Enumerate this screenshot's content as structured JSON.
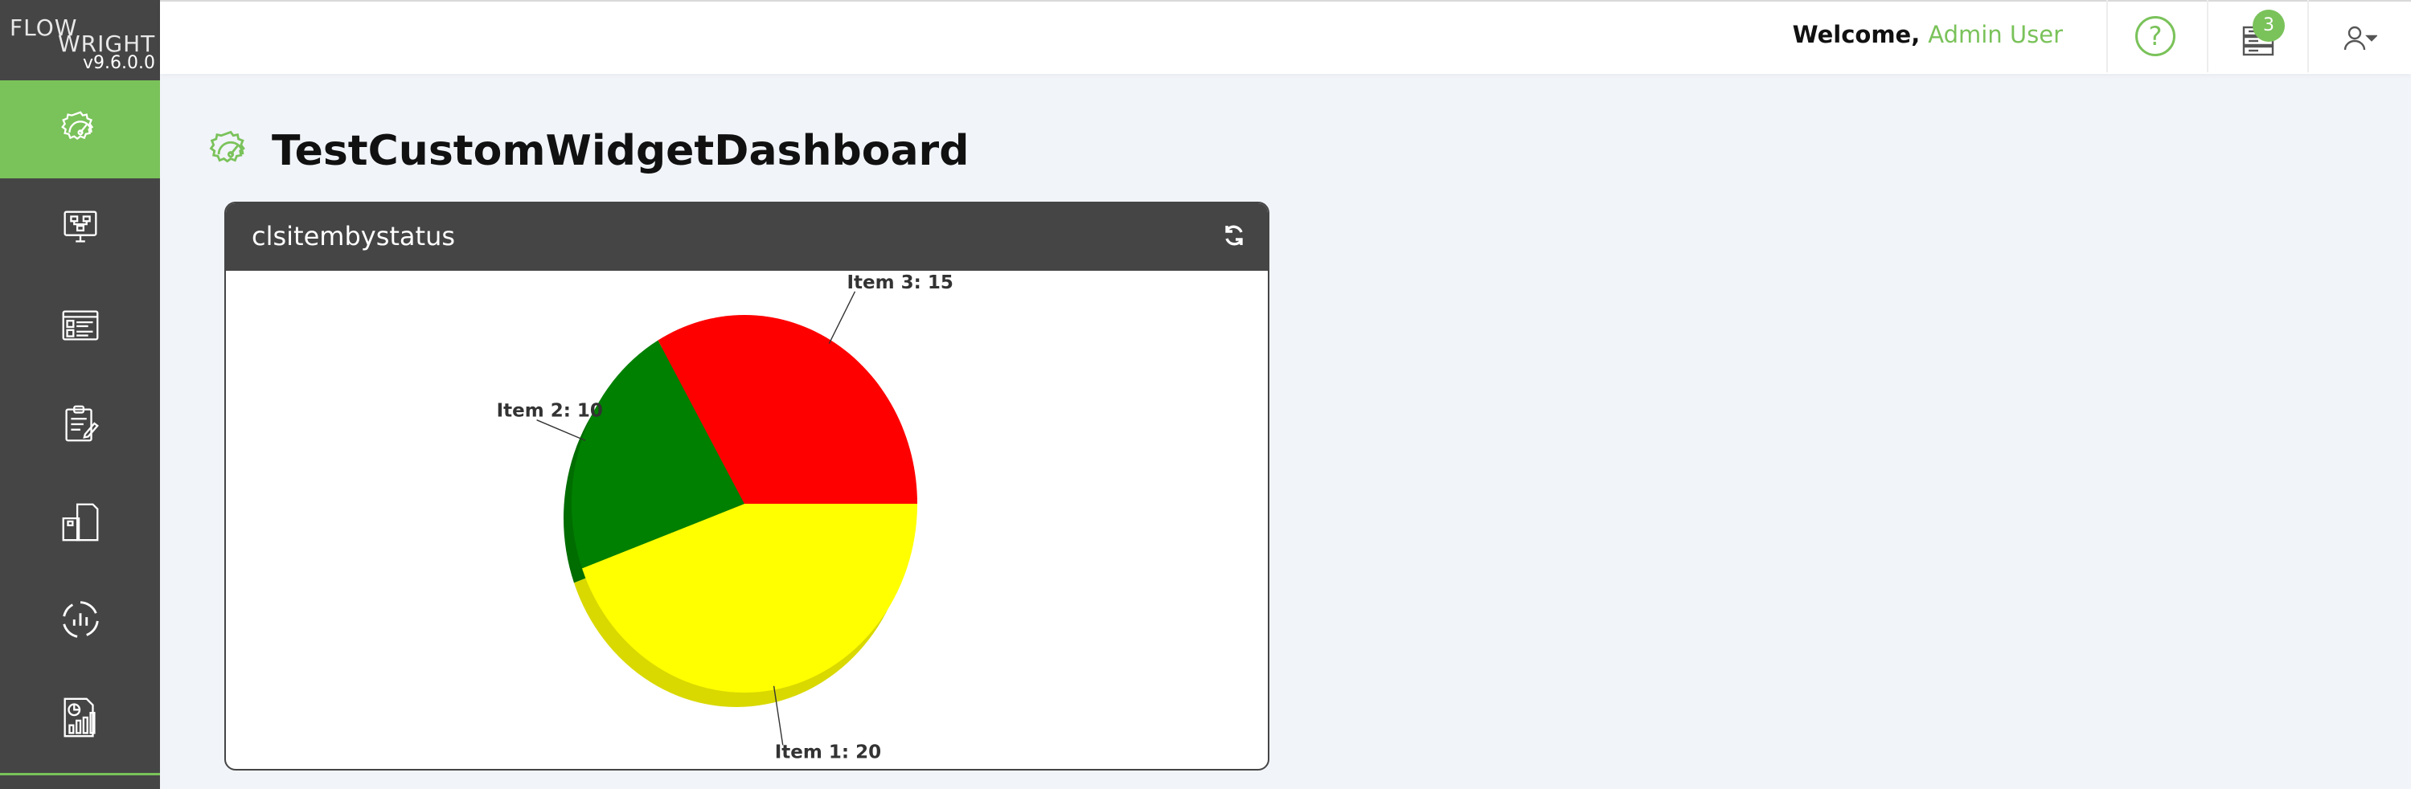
{
  "brand": {
    "logo_line1": "FLOW",
    "logo_line2": "WRIGHT",
    "version": "v9.6.0.0"
  },
  "sidebar": {
    "items": [
      {
        "name": "dashboard-gauge-icon",
        "active": true
      },
      {
        "name": "workflow-monitor-icon",
        "active": false
      },
      {
        "name": "forms-icon",
        "active": false
      },
      {
        "name": "tasks-clipboard-icon",
        "active": false
      },
      {
        "name": "documents-icon",
        "active": false
      },
      {
        "name": "analytics-cycle-icon",
        "active": false
      },
      {
        "name": "reports-icon",
        "active": false
      }
    ]
  },
  "header": {
    "welcome_label": "Welcome,",
    "user_name": "Admin User",
    "help_symbol": "?",
    "notification_count": "3"
  },
  "page": {
    "title": "TestCustomWidgetDashboard"
  },
  "widget": {
    "title": "clsitembystatus"
  },
  "chart_data": {
    "type": "pie",
    "style": "3d",
    "categories": [
      "Item 1",
      "Item 2",
      "Item 3"
    ],
    "values": [
      20,
      10,
      15
    ],
    "labels": [
      "Item 1: 20",
      "Item 2: 10",
      "Item 3: 15"
    ],
    "colors": [
      "#ffff00",
      "#008000",
      "#ff0000"
    ],
    "title": ""
  },
  "colors": {
    "accent": "#7ac25a",
    "sidebar": "#454545",
    "background": "#f1f4f9"
  }
}
